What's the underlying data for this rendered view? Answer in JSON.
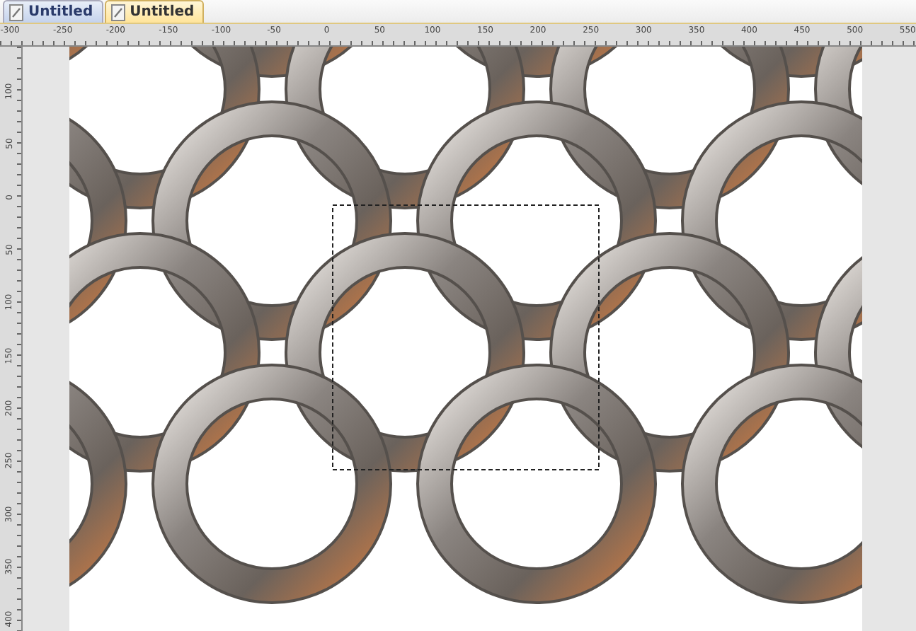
{
  "tabs": [
    {
      "label": "Untitled",
      "selected": false
    },
    {
      "label": "Untitled",
      "selected": true
    }
  ],
  "horizontal_ruler": {
    "labels": [
      "-300",
      "-250",
      "-200",
      "-150",
      "-100",
      "-50",
      "0",
      "50",
      "100",
      "150",
      "200",
      "250",
      "300",
      "350",
      "400",
      "450",
      "500",
      "550"
    ]
  },
  "vertical_ruler": {
    "labels": [
      "100",
      "50",
      "0",
      "50",
      "100",
      "150",
      "200",
      "250",
      "300",
      "350",
      "400"
    ]
  }
}
